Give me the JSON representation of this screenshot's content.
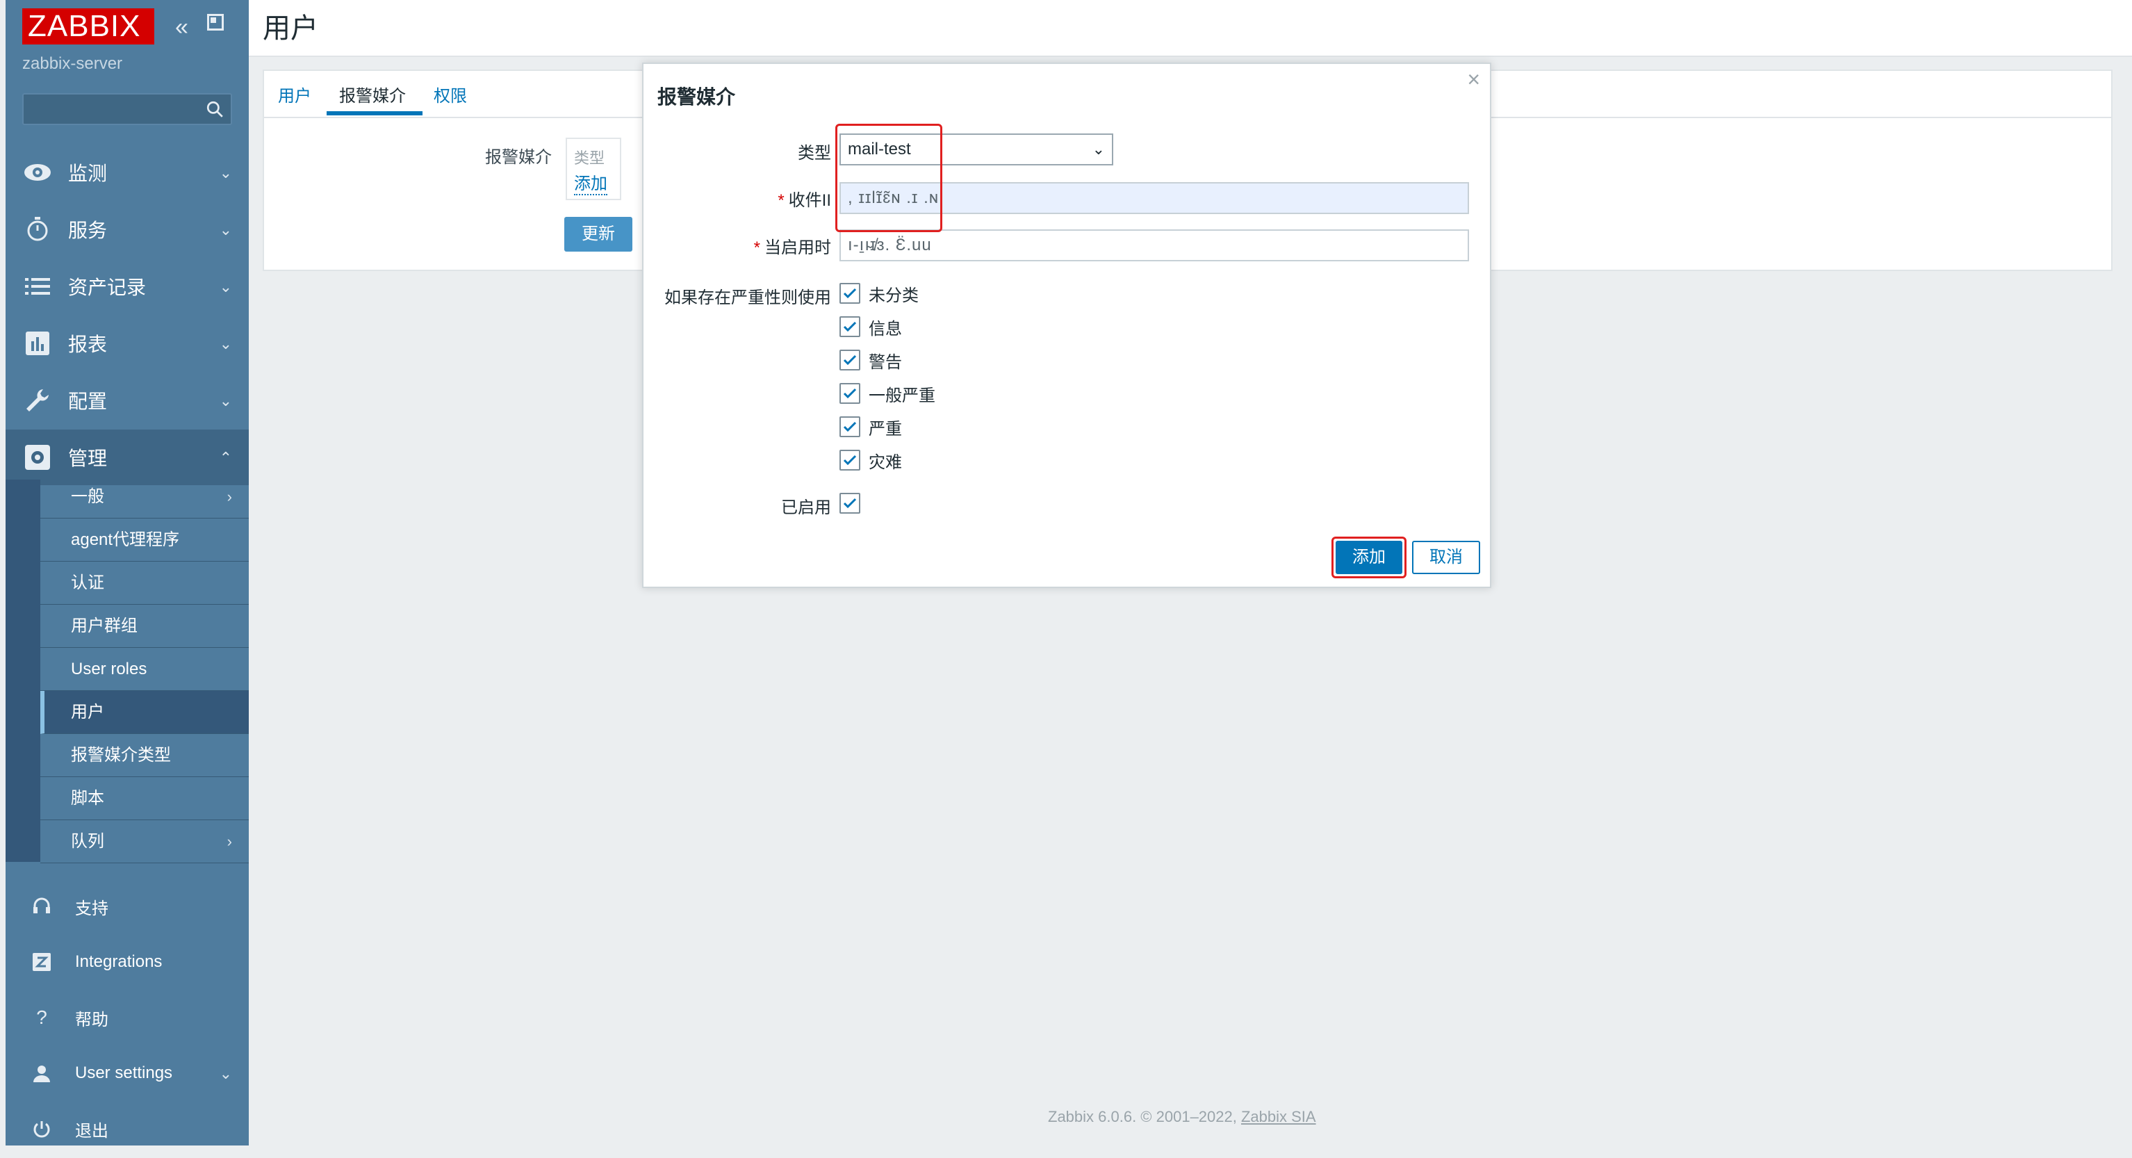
{
  "brand": {
    "logo_text": "ZABBIX",
    "server_name": "zabbix-server"
  },
  "sidebar": {
    "menu": [
      {
        "label": "监测",
        "icon": "eye-icon"
      },
      {
        "label": "服务",
        "icon": "clock-icon"
      },
      {
        "label": "资产记录",
        "icon": "list-icon"
      },
      {
        "label": "报表",
        "icon": "bar-chart-icon"
      },
      {
        "label": "配置",
        "icon": "wrench-icon"
      },
      {
        "label": "管理",
        "icon": "gear-icon"
      }
    ],
    "admin_submenu": [
      {
        "label": "一般"
      },
      {
        "label": "agent代理程序"
      },
      {
        "label": "认证"
      },
      {
        "label": "用户群组"
      },
      {
        "label": "User roles"
      },
      {
        "label": "用户"
      },
      {
        "label": "报警媒介类型"
      },
      {
        "label": "脚本"
      },
      {
        "label": "队列"
      }
    ],
    "footer": [
      {
        "label": "支持",
        "icon": "headset-icon"
      },
      {
        "label": "Integrations",
        "icon": "z-icon"
      },
      {
        "label": "帮助",
        "icon": "question-icon"
      },
      {
        "label": "User settings",
        "icon": "user-icon"
      },
      {
        "label": "退出",
        "icon": "power-icon"
      }
    ]
  },
  "page": {
    "title": "用户",
    "tabs": [
      {
        "label": "用户"
      },
      {
        "label": "报警媒介"
      },
      {
        "label": "权限"
      }
    ],
    "media_label": "报警媒介",
    "media_table_header": "类型",
    "media_add_link": "添加",
    "update_button": "更新"
  },
  "dialog": {
    "title": "报警媒介",
    "type_label": "类型",
    "type_value": "mail-test",
    "recipient_label": "收件II",
    "recipient_value": ", ɪɪlɪ̃ɛ̃ɴ .ɪ .ɴ",
    "period_label": "当启用时",
    "period_value": "ı-ı̱ı̴ɪ̸ɜ. Ɛ̈.uu",
    "severity_label": "如果存在严重性则使用",
    "severities": [
      {
        "label": "未分类",
        "checked": true
      },
      {
        "label": "信息",
        "checked": true
      },
      {
        "label": "警告",
        "checked": true
      },
      {
        "label": "一般严重",
        "checked": true
      },
      {
        "label": "严重",
        "checked": true
      },
      {
        "label": "灾难",
        "checked": true
      }
    ],
    "enabled_label": "已启用",
    "enabled": true,
    "add_button": "添加",
    "cancel_button": "取消",
    "close_symbol": "×"
  },
  "footer": {
    "text": "Zabbix 6.0.6. © 2001–2022, ",
    "link": "Zabbix SIA"
  },
  "colors": {
    "sidebar": "#4f7c9e",
    "accent": "#0275b8",
    "logo": "#d40000",
    "highlight": "#e02020"
  }
}
